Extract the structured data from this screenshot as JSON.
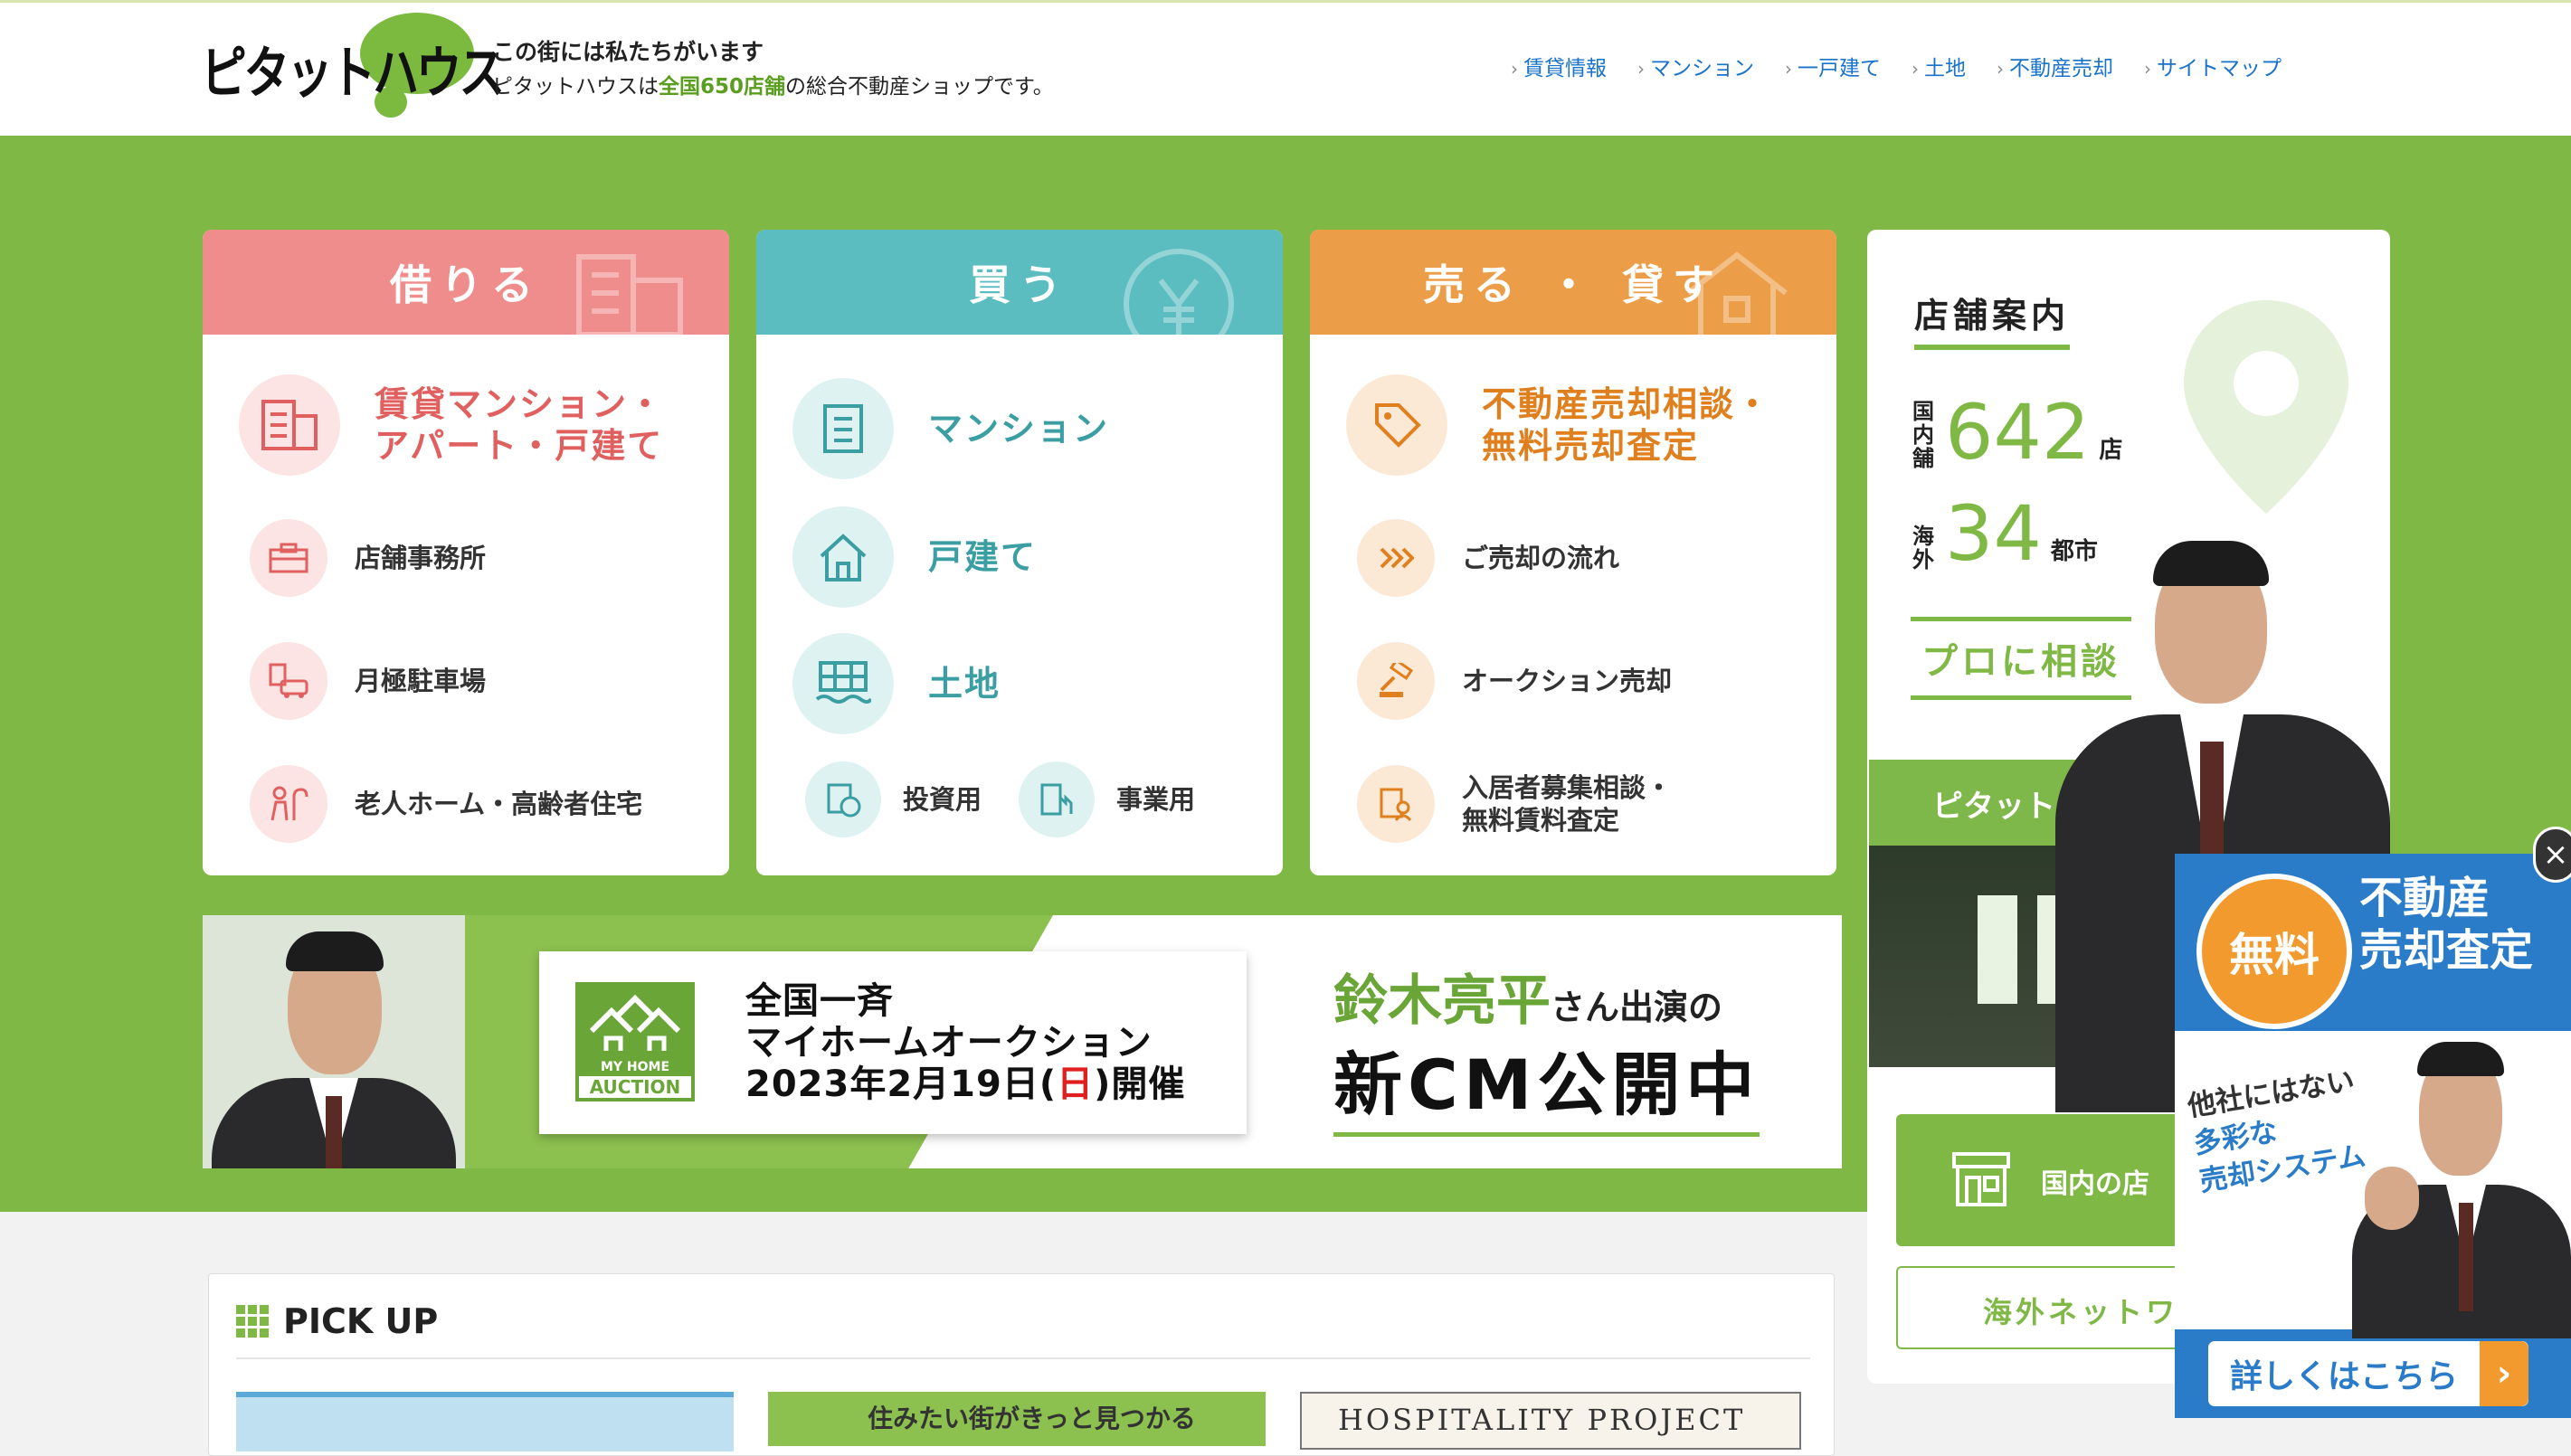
{
  "header": {
    "logo_text": "ピタットハウス",
    "tagline_1": "この街には私たちがいます",
    "tagline_2_pre": "ピタットハウスは",
    "tagline_2_hl": "全国650店舗",
    "tagline_2_post": "の総合不動産ショップです。",
    "nav": [
      {
        "label": "賃貸情報"
      },
      {
        "label": "マンション"
      },
      {
        "label": "一戸建て"
      },
      {
        "label": "土地"
      },
      {
        "label": "不動産売却"
      },
      {
        "label": "サイトマップ"
      }
    ]
  },
  "cards": {
    "rent": {
      "title": "借りる",
      "main": "賃貸マンション・\nアパート・戸建て",
      "items": [
        {
          "label": "店舗事務所",
          "icon": "office-icon"
        },
        {
          "label": "月極駐車場",
          "icon": "parking-icon"
        },
        {
          "label": "老人ホーム・高齢者住宅",
          "icon": "elderly-home-icon"
        }
      ]
    },
    "buy": {
      "title": "買う",
      "items": [
        {
          "label": "マンション",
          "icon": "mansion-icon"
        },
        {
          "label": "戸建て",
          "icon": "house-icon"
        },
        {
          "label": "土地",
          "icon": "land-icon"
        }
      ],
      "small": [
        {
          "label": "投資用",
          "icon": "investment-icon"
        },
        {
          "label": "事業用",
          "icon": "business-icon"
        }
      ]
    },
    "sell": {
      "title": "売る ・ 貸す",
      "main": "不動産売却相談・\n無料売却査定",
      "items": [
        {
          "label": "ご売却の流れ",
          "icon": "flow-icon"
        },
        {
          "label": "オークション売却",
          "icon": "auction-icon"
        },
        {
          "label": "入居者募集相談・\n無料賃料査定",
          "icon": "tenant-icon"
        }
      ]
    }
  },
  "store": {
    "title": "店舗案内",
    "domestic_label": "国内舗",
    "domestic_count": "642",
    "domestic_unit": "店",
    "overseas_label": "海外",
    "overseas_count": "34",
    "overseas_unit": "都市",
    "pro_label": "プロに相談",
    "shop_sign": "ピタットハウス",
    "btn_domestic": "国内の店",
    "btn_overseas": "海外ネットワ"
  },
  "banner": {
    "auction_logo_top": "MY HOME",
    "auction_logo_bottom": "AUCTION",
    "auction_line1": "全国一斉",
    "auction_line2": "マイホームオークション",
    "auction_line3_pre": "2023年2月19日(",
    "auction_line3_day": "日",
    "auction_line3_post": ")開催",
    "cm_name": "鈴木亮平",
    "cm_suffix": "さん出演の",
    "cm_headline": "新CM公開中"
  },
  "pickup": {
    "title": "PICK UP",
    "thumb2_text": "住みたい街がきっと見つかる",
    "thumb3_text": "HOSPITALITY PROJECT"
  },
  "popup": {
    "close": "×",
    "badge": "無料",
    "title": "不動産\n売却査定",
    "note_1": "他社にはない",
    "note_2": "多彩な",
    "note_3": "売却システム",
    "button": "詳しくはこちら",
    "arrow": "›"
  },
  "colors": {
    "green": "#80b845",
    "pink": "#ef8d8c",
    "teal": "#5cbdc1",
    "orange": "#ec9d48",
    "link_blue": "#1a73c9",
    "popup_blue": "#2a7bc8"
  }
}
